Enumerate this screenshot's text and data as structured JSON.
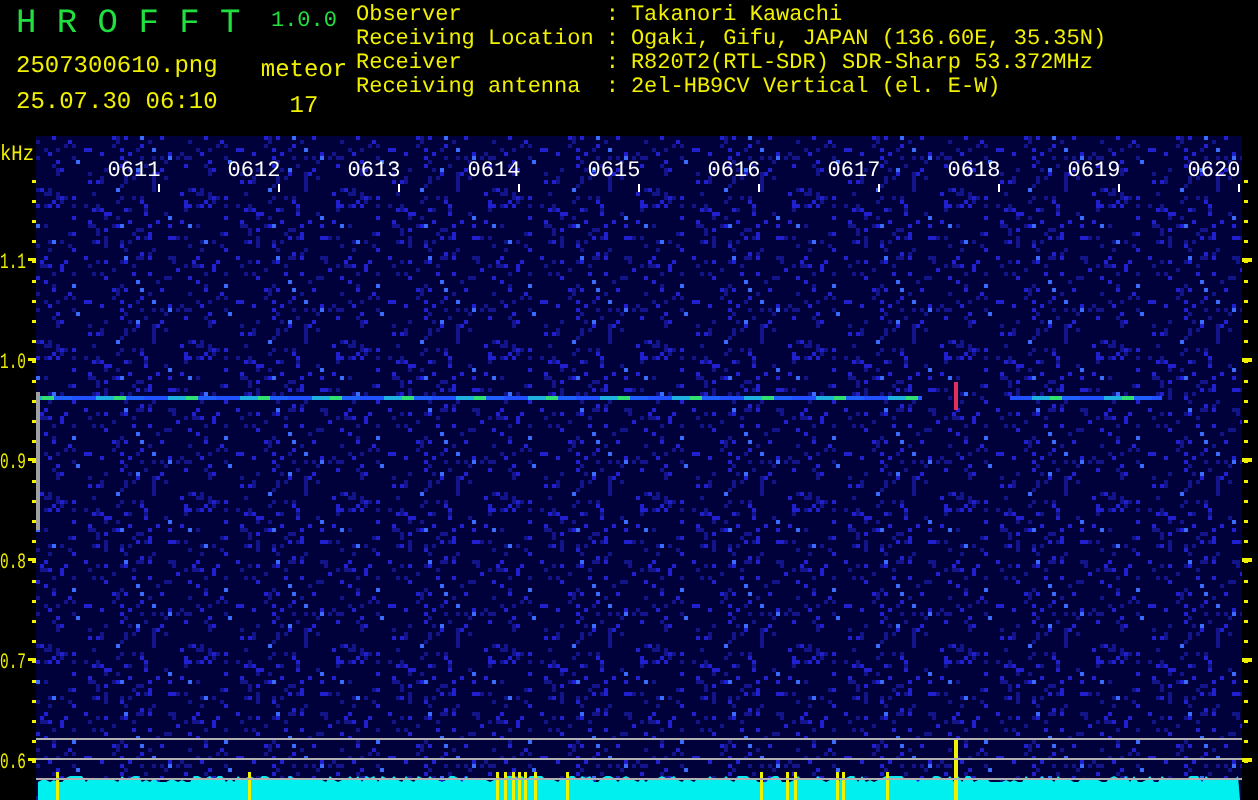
{
  "app": {
    "title": "H R O F F T",
    "version": "1.0.0"
  },
  "file": {
    "name": "2507300610.png",
    "datetime": "25.07.30 06:10"
  },
  "counter": {
    "label": "meteor",
    "value": "17"
  },
  "station": [
    {
      "label": "Observer",
      "colon": ":",
      "value": "Takanori Kawachi"
    },
    {
      "label": "Receiving Location",
      "colon": ":",
      "value": "Ogaki, Gifu, JAPAN (136.60E, 35.35N)"
    },
    {
      "label": "Receiver",
      "colon": ":",
      "value": "R820T2(RTL-SDR) SDR-Sharp 53.372MHz"
    },
    {
      "label": "Receiving antenna",
      "colon": ":",
      "value": "2el-HB9CV Vertical (el. E-W)"
    }
  ],
  "spectrogram": {
    "unit": "kHz",
    "time_labels": [
      "0611",
      "0612",
      "0613",
      "0614",
      "0615",
      "0616",
      "0617",
      "0618",
      "0619",
      "0620"
    ],
    "freq_labels": [
      "1.1",
      "1.0",
      "0.9",
      "0.8",
      "0.7",
      "0.6"
    ]
  }
}
